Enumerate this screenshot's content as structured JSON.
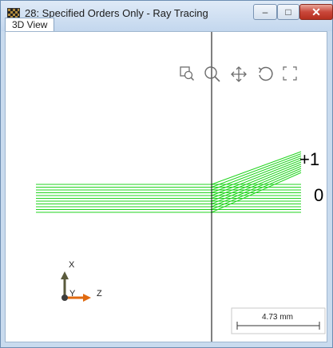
{
  "window": {
    "title": "28: Specified Orders Only - Ray Tracing",
    "controls": {
      "minimize": "–",
      "maximize": "□",
      "close": "✕"
    }
  },
  "tabs": [
    {
      "label": "3D View",
      "active": true
    }
  ],
  "toolbar": [
    {
      "name": "zoom-window-icon"
    },
    {
      "name": "zoom-icon"
    },
    {
      "name": "pan-icon"
    },
    {
      "name": "rotate-icon"
    },
    {
      "name": "fullscreen-icon"
    }
  ],
  "view": {
    "order_labels": {
      "plus_one": "+1",
      "zero": "0"
    },
    "axes": {
      "x": "X",
      "y": "Y",
      "z": "Z"
    },
    "scale_bar": "4.73 mm",
    "ray_color": "#22d41f"
  }
}
